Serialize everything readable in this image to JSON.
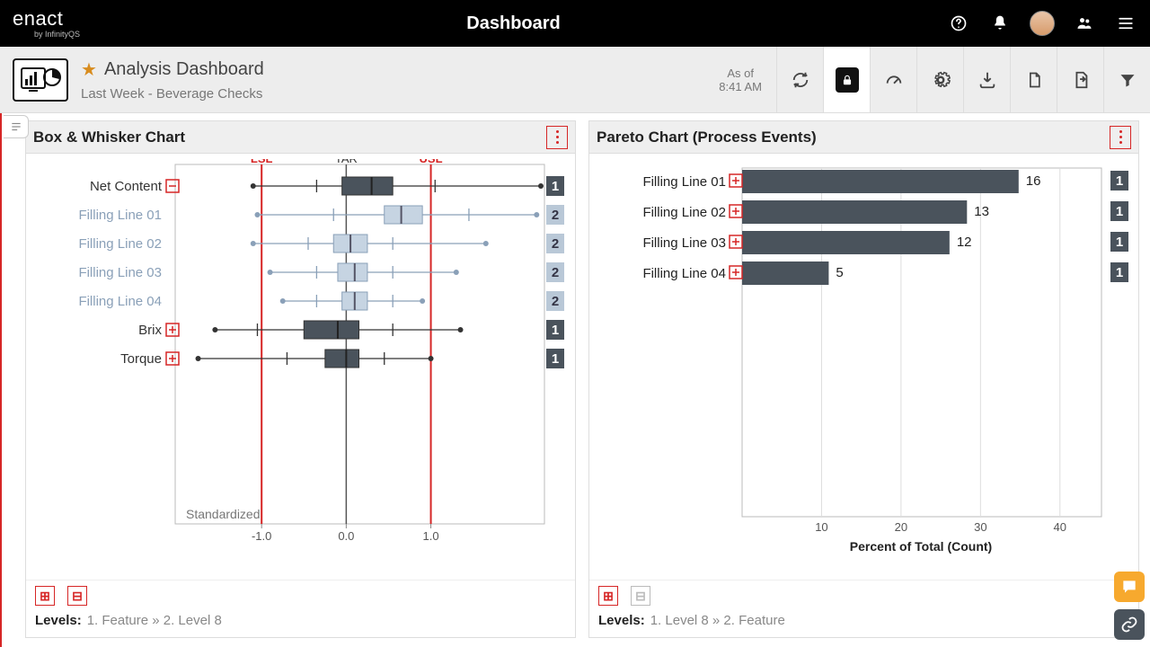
{
  "topbar": {
    "brand": "enact",
    "subbrand": "by InfinityQS",
    "title": "Dashboard"
  },
  "subheader": {
    "page_title": "Analysis Dashboard",
    "context_line": "Last Week - Beverage Checks",
    "asof_label": "As of",
    "asof_time": "8:41 AM"
  },
  "panel_box": {
    "title": "Box & Whisker Chart",
    "axis_label": "Standardized",
    "lsl_label": "LSL",
    "tar_label": "TAR",
    "usl_label": "USL",
    "ticks": [
      "-1.0",
      "0.0",
      "1.0"
    ],
    "levels_label": "Levels:",
    "levels_path": "1. Feature » 2. Level 8",
    "rows": [
      {
        "label": "Net Content",
        "expanded": true,
        "count": "1",
        "light": false
      },
      {
        "label": "Filling Line 01",
        "count": "2",
        "light": true
      },
      {
        "label": "Filling Line 02",
        "count": "2",
        "light": true
      },
      {
        "label": "Filling Line 03",
        "count": "2",
        "light": true
      },
      {
        "label": "Filling Line 04",
        "count": "2",
        "light": true
      },
      {
        "label": "Brix",
        "expanded": false,
        "count": "1",
        "light": false
      },
      {
        "label": "Torque",
        "expanded": false,
        "count": "1",
        "light": false
      }
    ]
  },
  "panel_pareto": {
    "title": "Pareto Chart (Process Events)",
    "axis_title": "Percent of Total (Count)",
    "ticks": [
      "10",
      "20",
      "30",
      "40"
    ],
    "levels_label": "Levels:",
    "levels_path": "1. Level 8 » 2. Feature",
    "bars": [
      {
        "label": "Filling Line 01",
        "value": "16",
        "badge": "1"
      },
      {
        "label": "Filling Line 02",
        "value": "13",
        "badge": "1"
      },
      {
        "label": "Filling Line 03",
        "value": "12",
        "badge": "1"
      },
      {
        "label": "Filling Line 04",
        "value": "5",
        "badge": "1"
      }
    ]
  },
  "chart_data": [
    {
      "type": "boxplot",
      "title": "Box & Whisker Chart",
      "xlabel": "Standardized",
      "xlim": [
        -2.0,
        2.3
      ],
      "x_ticks": [
        -1.0,
        0.0,
        1.0
      ],
      "reference_lines": {
        "LSL": -1.0,
        "TAR": 0.0,
        "USL": 1.0
      },
      "series": [
        {
          "name": "Net Content",
          "group": "parent",
          "min": -1.1,
          "q1": -0.05,
          "median": 0.3,
          "q3": 0.55,
          "max": 2.3,
          "whisker_ticks": [
            -0.35,
            1.05
          ],
          "count": 1
        },
        {
          "name": "Filling Line 01",
          "group": "child",
          "min": -1.05,
          "q1": 0.45,
          "median": 0.65,
          "q3": 0.9,
          "max": 2.25,
          "whisker_ticks": [
            -0.15,
            1.45
          ],
          "count": 2
        },
        {
          "name": "Filling Line 02",
          "group": "child",
          "min": -1.1,
          "q1": -0.15,
          "median": 0.05,
          "q3": 0.25,
          "max": 1.65,
          "whisker_ticks": [
            -0.45,
            0.55
          ],
          "count": 2
        },
        {
          "name": "Filling Line 03",
          "group": "child",
          "min": -0.9,
          "q1": -0.1,
          "median": 0.1,
          "q3": 0.25,
          "max": 1.3,
          "whisker_ticks": [
            -0.35,
            0.55
          ],
          "count": 2
        },
        {
          "name": "Filling Line 04",
          "group": "child",
          "min": -0.75,
          "q1": -0.05,
          "median": 0.1,
          "q3": 0.25,
          "max": 0.9,
          "whisker_ticks": [
            -0.35,
            0.55
          ],
          "count": 2
        },
        {
          "name": "Brix",
          "group": "parent",
          "min": -1.55,
          "q1": -0.5,
          "median": -0.1,
          "q3": 0.15,
          "max": 1.35,
          "whisker_ticks": [
            -1.05,
            0.55
          ],
          "count": 1
        },
        {
          "name": "Torque",
          "group": "parent",
          "min": -1.75,
          "q1": -0.25,
          "median": 0.0,
          "q3": 0.15,
          "max": 1.0,
          "whisker_ticks": [
            -0.7,
            0.45
          ],
          "count": 1
        }
      ]
    },
    {
      "type": "bar",
      "orientation": "horizontal",
      "title": "Pareto Chart (Process Events)",
      "xlabel": "Percent of Total (Count)",
      "xlim": [
        0,
        45
      ],
      "x_ticks": [
        10,
        20,
        30,
        40
      ],
      "categories": [
        "Filling Line 01",
        "Filling Line 02",
        "Filling Line 03",
        "Filling Line 04"
      ],
      "values_pct": [
        34.8,
        28.3,
        26.1,
        10.9
      ],
      "data_labels_count": [
        16,
        13,
        12,
        5
      ],
      "badge": [
        1,
        1,
        1,
        1
      ]
    }
  ]
}
